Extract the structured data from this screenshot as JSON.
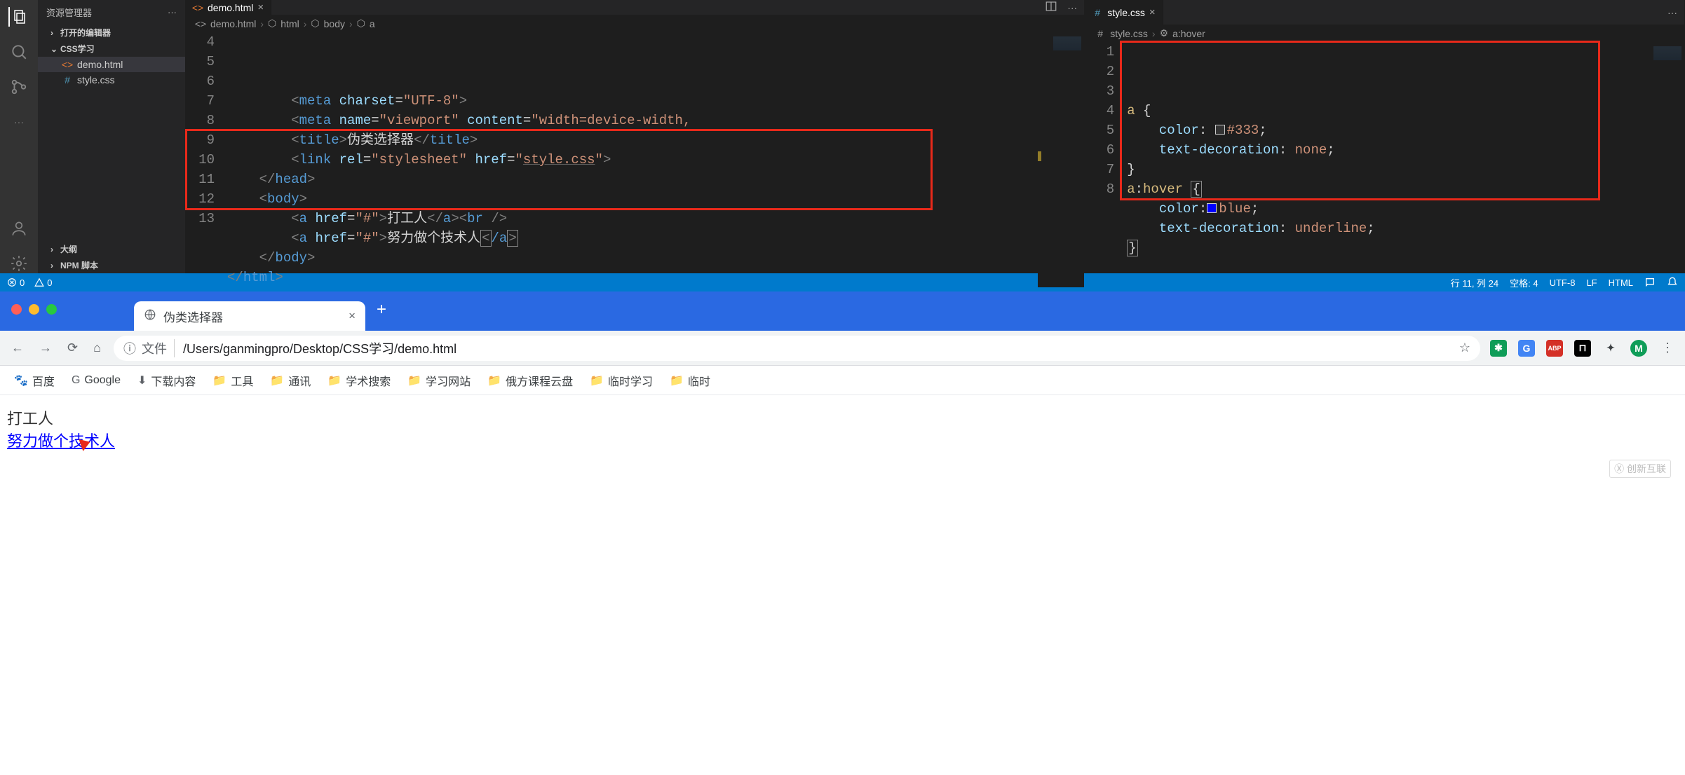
{
  "vscode": {
    "explorer_title": "资源管理器",
    "sections": {
      "open_editors": "打开的编辑器",
      "project": "CSS学习",
      "outline": "大纲",
      "npm": "NPM 脚本"
    },
    "files": [
      {
        "name": "demo.html",
        "type": "html",
        "active": true
      },
      {
        "name": "style.css",
        "type": "css",
        "active": false
      }
    ],
    "left_editor": {
      "tab": "demo.html",
      "breadcrumb": [
        "demo.html",
        "html",
        "body",
        "a"
      ],
      "lines_start": 4,
      "code": [
        {
          "indent": 2,
          "tokens": [
            [
              "angle",
              "<"
            ],
            [
              "tag",
              "meta"
            ],
            [
              "text",
              " "
            ],
            [
              "attr",
              "charset"
            ],
            [
              "punct",
              "="
            ],
            [
              "str",
              "\"UTF-8\""
            ],
            [
              "angle",
              ">"
            ]
          ]
        },
        {
          "indent": 2,
          "tokens": [
            [
              "angle",
              "<"
            ],
            [
              "tag",
              "meta"
            ],
            [
              "text",
              " "
            ],
            [
              "attr",
              "name"
            ],
            [
              "punct",
              "="
            ],
            [
              "str",
              "\"viewport\""
            ],
            [
              "text",
              " "
            ],
            [
              "attr",
              "content"
            ],
            [
              "punct",
              "="
            ],
            [
              "str",
              "\"width=device-width,"
            ]
          ]
        },
        {
          "indent": 2,
          "tokens": [
            [
              "angle",
              "<"
            ],
            [
              "tag",
              "title"
            ],
            [
              "angle",
              ">"
            ],
            [
              "text",
              "伪类选择器"
            ],
            [
              "angle",
              "</"
            ],
            [
              "tag",
              "title"
            ],
            [
              "angle",
              ">"
            ]
          ]
        },
        {
          "indent": 2,
          "tokens": [
            [
              "angle",
              "<"
            ],
            [
              "tag",
              "link"
            ],
            [
              "text",
              " "
            ],
            [
              "attr",
              "rel"
            ],
            [
              "punct",
              "="
            ],
            [
              "str",
              "\"stylesheet\""
            ],
            [
              "text",
              " "
            ],
            [
              "attr",
              "href"
            ],
            [
              "punct",
              "="
            ],
            [
              "str",
              "\""
            ],
            [
              "strunder",
              "style.css"
            ],
            [
              "str",
              "\""
            ],
            [
              "angle",
              ">"
            ]
          ]
        },
        {
          "indent": 1,
          "tokens": [
            [
              "angle",
              "</"
            ],
            [
              "tag",
              "head"
            ],
            [
              "angle",
              ">"
            ]
          ]
        },
        {
          "indent": 1,
          "tokens": [
            [
              "angle",
              "<"
            ],
            [
              "tag",
              "body"
            ],
            [
              "angle",
              ">"
            ]
          ]
        },
        {
          "indent": 2,
          "tokens": [
            [
              "angle",
              "<"
            ],
            [
              "tag",
              "a"
            ],
            [
              "text",
              " "
            ],
            [
              "attr",
              "href"
            ],
            [
              "punct",
              "="
            ],
            [
              "str",
              "\"#\""
            ],
            [
              "angle",
              ">"
            ],
            [
              "text",
              "打工人"
            ],
            [
              "angle",
              "</"
            ],
            [
              "tag",
              "a"
            ],
            [
              "angle",
              ">"
            ],
            [
              "angle",
              "<"
            ],
            [
              "tag",
              "br"
            ],
            [
              "text",
              " "
            ],
            [
              "angle",
              "/>"
            ]
          ]
        },
        {
          "indent": 2,
          "tokens": [
            [
              "angle",
              "<"
            ],
            [
              "tag",
              "a"
            ],
            [
              "text",
              " "
            ],
            [
              "attr",
              "href"
            ],
            [
              "punct",
              "="
            ],
            [
              "str",
              "\"#\""
            ],
            [
              "angle",
              ">"
            ],
            [
              "text",
              "努力做个技术人"
            ],
            [
              "cursorstart",
              "<"
            ],
            [
              "cursortag",
              "/a"
            ],
            [
              "cursorend",
              ">"
            ]
          ]
        },
        {
          "indent": 1,
          "tokens": [
            [
              "angle",
              "</"
            ],
            [
              "tag",
              "body"
            ],
            [
              "angle",
              ">"
            ]
          ]
        },
        {
          "indent": 0,
          "tokens": [
            [
              "angle",
              "</"
            ],
            [
              "tag",
              "html"
            ],
            [
              "angle",
              ">"
            ]
          ]
        }
      ],
      "redbox": {
        "fromLine": 9,
        "toLine": 12
      }
    },
    "right_editor": {
      "tab": "style.css",
      "breadcrumb": [
        "style.css",
        "a:hover"
      ],
      "lines_start": 1,
      "code": [
        {
          "tokens": [
            [
              "sel",
              "a"
            ],
            [
              "text",
              " "
            ],
            [
              "punct",
              "{"
            ]
          ]
        },
        {
          "tokens": [
            [
              "text",
              "    "
            ],
            [
              "prop",
              "color"
            ],
            [
              "punct",
              ": "
            ],
            [
              "swatch",
              "#333333"
            ],
            [
              "val",
              "#333"
            ],
            [
              "punct",
              ";"
            ]
          ]
        },
        {
          "tokens": [
            [
              "text",
              "    "
            ],
            [
              "prop",
              "text-decoration"
            ],
            [
              "punct",
              ": "
            ],
            [
              "val",
              "none"
            ],
            [
              "punct",
              ";"
            ]
          ]
        },
        {
          "tokens": [
            [
              "punct",
              "}"
            ]
          ]
        },
        {
          "tokens": [
            [
              "sel",
              "a"
            ],
            [
              "punct",
              ":"
            ],
            [
              "sel",
              "hover"
            ],
            [
              "text",
              " "
            ],
            [
              "punctbox",
              "{"
            ]
          ]
        },
        {
          "tokens": [
            [
              "text",
              "    "
            ],
            [
              "prop",
              "color"
            ],
            [
              "punct",
              ":"
            ],
            [
              "swatch",
              "#0000ff"
            ],
            [
              "val",
              "blue"
            ],
            [
              "punct",
              ";"
            ]
          ]
        },
        {
          "tokens": [
            [
              "text",
              "    "
            ],
            [
              "prop",
              "text-decoration"
            ],
            [
              "punct",
              ": "
            ],
            [
              "val",
              "underline"
            ],
            [
              "punct",
              ";"
            ]
          ]
        },
        {
          "tokens": [
            [
              "punctbox",
              "}"
            ]
          ]
        }
      ],
      "redbox": {
        "fromLine": 1,
        "toLine": 8
      }
    },
    "statusbar": {
      "errors": "0",
      "warnings": "0",
      "position": "行 11, 列 24",
      "spaces": "空格: 4",
      "encoding": "UTF-8",
      "eol": "LF",
      "lang": "HTML"
    }
  },
  "browser": {
    "tab_title": "伪类选择器",
    "address_label": "文件",
    "address_path": "/Users/ganmingpro/Desktop/CSS学习/demo.html",
    "bookmarks": [
      "百度",
      "Google",
      "下载内容",
      "工具",
      "通讯",
      "学术搜索",
      "学习网站",
      "俄方课程云盘",
      "临时学习",
      "临时"
    ],
    "page": {
      "link1": "打工人",
      "link2": "努力做个技术人"
    },
    "watermark": "创新互联",
    "ext_avatar": "M"
  }
}
